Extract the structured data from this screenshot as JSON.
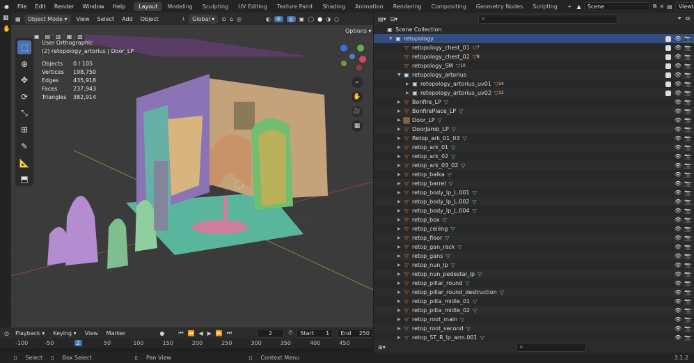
{
  "menus": [
    "File",
    "Edit",
    "Render",
    "Window",
    "Help"
  ],
  "workspaces": [
    {
      "label": "Layout",
      "active": true
    },
    {
      "label": "Modeling"
    },
    {
      "label": "Sculpting"
    },
    {
      "label": "UV Editing"
    },
    {
      "label": "Texture Paint"
    },
    {
      "label": "Shading"
    },
    {
      "label": "Animation"
    },
    {
      "label": "Rendering"
    },
    {
      "label": "Compositing"
    },
    {
      "label": "Geometry Nodes"
    },
    {
      "label": "Scripting"
    }
  ],
  "scene": "Scene",
  "viewlayer": "ViewLayer",
  "header": {
    "mode": "Object Mode",
    "view": "View",
    "select": "Select",
    "add": "Add",
    "object": "Object",
    "orientation": "Global",
    "options": "Options"
  },
  "viewport": {
    "view_name": "User Orthographic",
    "object_name": "(2) retopology_artorius | Door_LP",
    "stats": [
      {
        "k": "Objects",
        "v": "0 / 105"
      },
      {
        "k": "Vertices",
        "v": "198,750"
      },
      {
        "k": "Edges",
        "v": "435,918"
      },
      {
        "k": "Faces",
        "v": "237,943"
      },
      {
        "k": "Triangles",
        "v": "382,914"
      }
    ]
  },
  "timeline": {
    "playback": "Playback",
    "keying": "Keying",
    "view": "View",
    "marker": "Marker",
    "current": "2",
    "start_label": "Start",
    "start": "1",
    "end_label": "End",
    "end": "250",
    "ticks": [
      "-100",
      "-50",
      "2",
      "50",
      "100",
      "150",
      "200",
      "250",
      "300",
      "350",
      "400",
      "450"
    ]
  },
  "status": {
    "select": "Select",
    "box": "Box Select",
    "pan": "Pan View",
    "context": "Context Menu",
    "version": "3.1.2"
  },
  "outliner": {
    "rows": [
      {
        "label": "Scene Collection",
        "indent": 0,
        "type": "scene"
      },
      {
        "label": "retopology",
        "indent": 1,
        "type": "coll",
        "expand": "open",
        "sel": true,
        "chk": true
      },
      {
        "label": "retopology_chest_01",
        "indent": 2,
        "type": "mesh",
        "tri": "orange",
        "sub": "7",
        "chk": true
      },
      {
        "label": "retopology_chest_02",
        "indent": 2,
        "type": "mesh",
        "tri": "orange",
        "sub": "8",
        "chk": true
      },
      {
        "label": "retopology_SM",
        "indent": 2,
        "type": "mesh",
        "tri": "orange",
        "sub": "10",
        "chk": true
      },
      {
        "label": "retopology_artorius",
        "indent": 2,
        "type": "coll",
        "expand": "open",
        "chk": true
      },
      {
        "label": "retopology_artorius_uv01",
        "indent": 3,
        "type": "coll",
        "expand": "closed",
        "tri": "orange",
        "sub": "24",
        "chk": true
      },
      {
        "label": "retopology_artorius_uv02",
        "indent": 3,
        "type": "coll",
        "expand": "closed",
        "tri": "orange",
        "sub": "12",
        "chk": true
      },
      {
        "label": "Bonfire_LP",
        "indent": 2,
        "type": "mesh",
        "expand": "closed",
        "tri": "green"
      },
      {
        "label": "BonfirePlace_LP",
        "indent": 2,
        "type": "mesh",
        "expand": "closed",
        "tri": "green"
      },
      {
        "label": "Door_LP",
        "indent": 2,
        "type": "mesh",
        "expand": "closed",
        "tri": "green",
        "box": true
      },
      {
        "label": "DoorJamb_LP",
        "indent": 2,
        "type": "mesh",
        "expand": "closed",
        "tri": "green"
      },
      {
        "label": "Retop_ark_01_03",
        "indent": 2,
        "type": "mesh",
        "expand": "closed",
        "tri": "green"
      },
      {
        "label": "retop_ark_01",
        "indent": 2,
        "type": "mesh",
        "expand": "closed",
        "tri": "green"
      },
      {
        "label": "retop_ark_02",
        "indent": 2,
        "type": "mesh",
        "expand": "closed",
        "tri": "green"
      },
      {
        "label": "retop_ark_03_02",
        "indent": 2,
        "type": "mesh",
        "expand": "closed",
        "tri": "green"
      },
      {
        "label": "retop_balka",
        "indent": 2,
        "type": "mesh",
        "expand": "closed",
        "tri": "green"
      },
      {
        "label": "retop_barrel",
        "indent": 2,
        "type": "mesh",
        "expand": "closed",
        "tri": "green"
      },
      {
        "label": "retop_body_lp_L.001",
        "indent": 2,
        "type": "mesh",
        "expand": "closed",
        "tri": "green"
      },
      {
        "label": "retop_body_lp_L.002",
        "indent": 2,
        "type": "mesh",
        "expand": "closed",
        "tri": "green"
      },
      {
        "label": "retop_body_lp_L.004",
        "indent": 2,
        "type": "mesh",
        "expand": "closed",
        "tri": "green"
      },
      {
        "label": "retop_box",
        "indent": 2,
        "type": "mesh",
        "expand": "closed",
        "tri": "green"
      },
      {
        "label": "retop_ceiling",
        "indent": 2,
        "type": "mesh",
        "expand": "closed",
        "tri": "green"
      },
      {
        "label": "retop_floor",
        "indent": 2,
        "type": "mesh",
        "expand": "closed",
        "tri": "green"
      },
      {
        "label": "retop_gan_rack",
        "indent": 2,
        "type": "mesh",
        "expand": "closed",
        "tri": "green"
      },
      {
        "label": "retop_gans",
        "indent": 2,
        "type": "mesh",
        "expand": "closed",
        "tri": "green"
      },
      {
        "label": "retop_nun_lp",
        "indent": 2,
        "type": "mesh",
        "expand": "closed",
        "tri": "green"
      },
      {
        "label": "retop_nun_pedestal_lp",
        "indent": 2,
        "type": "mesh",
        "expand": "closed",
        "tri": "green"
      },
      {
        "label": "retop_pillar_round",
        "indent": 2,
        "type": "mesh",
        "expand": "closed",
        "tri": "green"
      },
      {
        "label": "retop_pillar_round_destruction",
        "indent": 2,
        "type": "mesh",
        "expand": "closed",
        "tri": "green"
      },
      {
        "label": "retop_plita_midle_01",
        "indent": 2,
        "type": "mesh",
        "expand": "closed",
        "tri": "green"
      },
      {
        "label": "retop_plita_midle_02",
        "indent": 2,
        "type": "mesh",
        "expand": "closed",
        "tri": "green"
      },
      {
        "label": "retop_root_main",
        "indent": 2,
        "type": "mesh",
        "expand": "closed",
        "tri": "green"
      },
      {
        "label": "retop_root_second",
        "indent": 2,
        "type": "mesh",
        "expand": "closed",
        "tri": "green"
      },
      {
        "label": "retop_ST_R_lp_arm.001",
        "indent": 2,
        "type": "mesh",
        "expand": "closed",
        "tri": "green"
      }
    ]
  }
}
